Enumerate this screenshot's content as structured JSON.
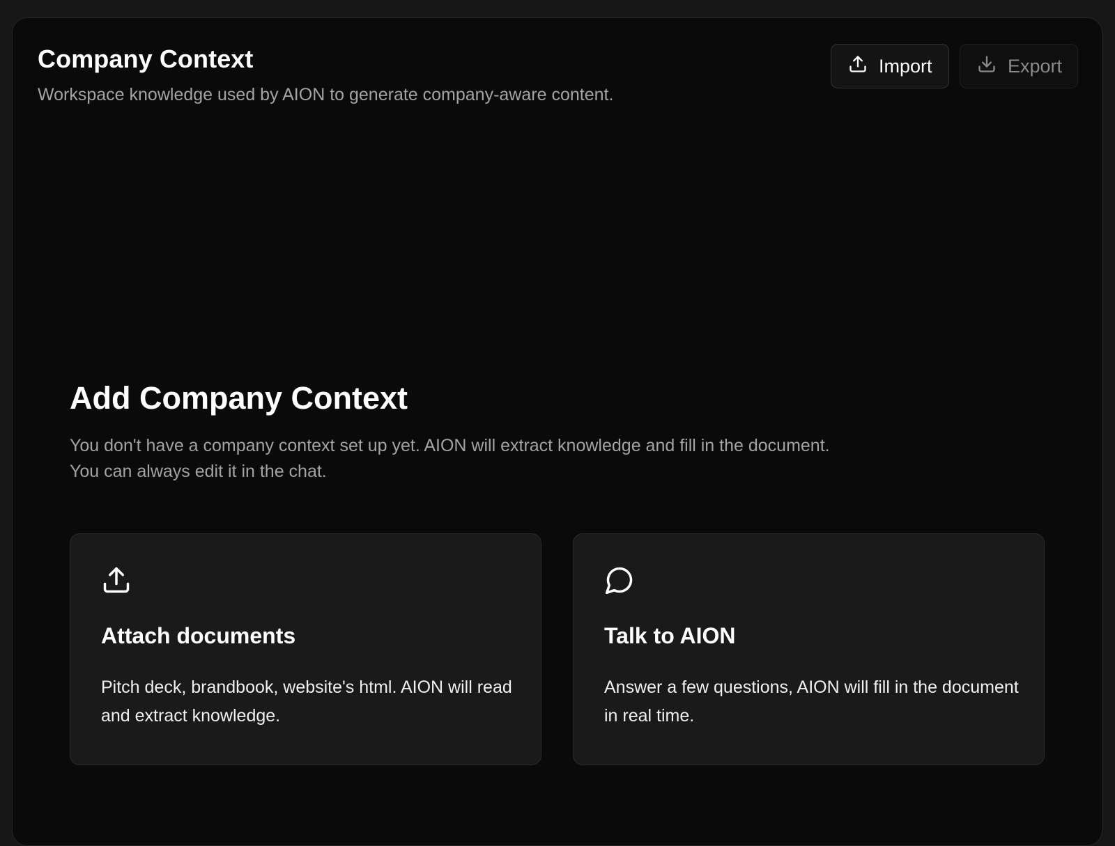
{
  "header": {
    "title": "Company Context",
    "subtitle": "Workspace knowledge used by AION to generate company-aware content."
  },
  "toolbar": {
    "import_label": "Import",
    "import_icon": "upload-icon",
    "export_label": "Export",
    "export_icon": "download-icon"
  },
  "empty_state": {
    "title": "Add Company Context",
    "description_lines": [
      "You don't have a company context set up yet. AION will extract knowledge and fill in the document.",
      "You can always edit it in the chat."
    ]
  },
  "cards": [
    {
      "icon": "upload-icon",
      "title": "Attach documents",
      "description": "Pitch deck, brandbook, website's html. AION will read and extract knowledge."
    },
    {
      "icon": "chat-bubble-icon",
      "title": "Talk to AION",
      "description": "Answer a few questions, AION will fill in the document in real time."
    }
  ],
  "colors": {
    "background": "#0a0a0a",
    "card": "#1a1a1a",
    "muted_text": "#a3a3a3",
    "text": "#ffffff"
  }
}
